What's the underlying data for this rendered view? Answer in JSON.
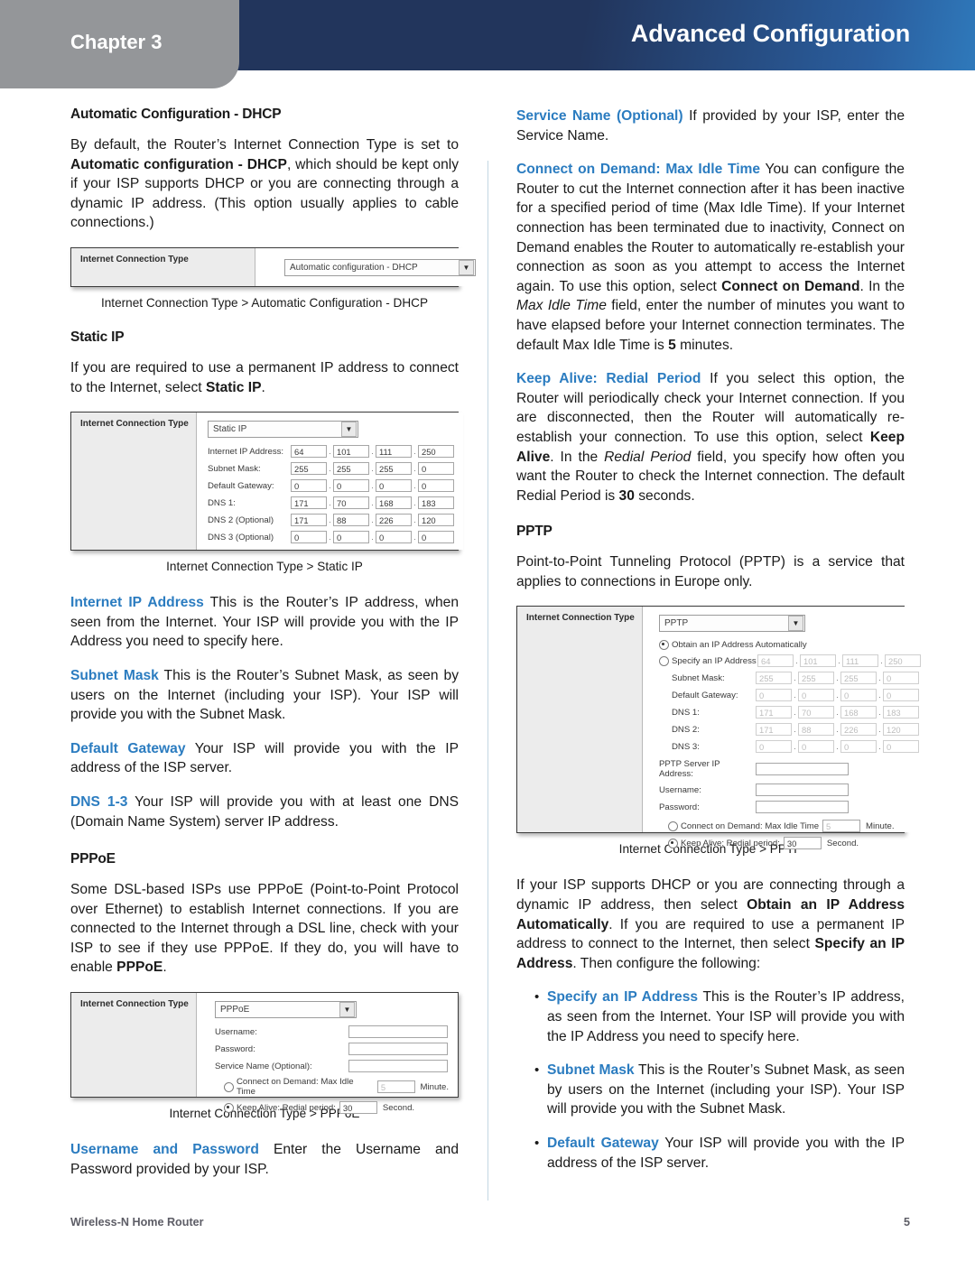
{
  "header": {
    "chapter_label": "Chapter 3",
    "title": "Advanced Configuration",
    "band_color_start": "#22355c",
    "band_color_end": "#2f79bb",
    "tab_color": "#949699"
  },
  "footer": {
    "document_name": "Wireless-N Home Router",
    "page_number": "5"
  },
  "accent_color": "#2b7cc0",
  "left_column": {
    "heading_dhcp": "Automatic Configuration - DHCP",
    "para_dhcp_1": "By default, the Router’s Internet Connection Type is set to ",
    "para_dhcp_1_bold": "Automatic configuration - DHCP",
    "para_dhcp_1_tail": ", which should be kept only if your ISP supports DHCP or you are connecting through a dynamic IP address. (This option usually applies to cable connections.)",
    "caption_dhcp": "Internet Connection Type > Automatic Configuration - DHCP",
    "heading_static": "Static IP",
    "para_static_1": "If you are required to use a permanent IP address to connect to the Internet, select ",
    "para_static_1_bold": "Static IP",
    "para_static_1_tail": ".",
    "caption_static": "Internet Connection Type > Static IP",
    "term_internet_ip": "Internet IP Address",
    "para_internet_ip": "  This is the Router’s IP address, when seen from the Internet. Your ISP will provide you with the IP Address you need to specify here.",
    "term_subnet_mask": "Subnet Mask",
    "para_subnet_mask": "  This is the Router’s Subnet Mask, as seen by users on the Internet (including your ISP). Your ISP will provide you with the Subnet Mask.",
    "term_default_gateway": "Default Gateway",
    "para_default_gateway": "  Your ISP will provide you with the IP address of the ISP server.",
    "term_dns": "DNS 1-3",
    "para_dns": "  Your ISP will provide you with at least one DNS (Domain Name System) server IP address.",
    "heading_pppoe": "PPPoE",
    "para_pppoe_1": "Some DSL-based ISPs use PPPoE (Point-to-Point Protocol over Ethernet) to establish Internet connections. If you are connected to the Internet through a DSL line, check with your ISP to see if they use PPPoE. If they do, you will have to enable ",
    "para_pppoe_1_bold": "PPPoE",
    "para_pppoe_1_tail": ".",
    "caption_pppoe": "Internet Connection Type > PPPoE",
    "term_username_password": "Username and Password",
    "para_username_password": "  Enter the Username and Password provided by your ISP."
  },
  "right_column": {
    "term_service_name": "Service Name (Optional)",
    "para_service_name": "  If provided by your ISP, enter the Service Name.",
    "term_connect_on_demand": "Connect on Demand: Max Idle Time",
    "para_cod_a": "  You can configure the Router to cut the Internet connection after it has been inactive for a specified period of time (Max Idle Time). If your Internet connection has been terminated due to inactivity, Connect on Demand enables the Router to automatically re-establish your connection as soon as you attempt to access the Internet again. To use this option, select ",
    "para_cod_bold1": "Connect on Demand",
    "para_cod_b": ". In the ",
    "para_cod_italic": "Max Idle Time",
    "para_cod_c": " field, enter the number of minutes you want to have elapsed before your Internet connection terminates. The default Max Idle Time is ",
    "para_cod_bold2": "5",
    "para_cod_d": " minutes.",
    "term_keep_alive": "Keep Alive: Redial Period",
    "para_ka_a": " If you select this option, the Router will periodically check your Internet connection. If you are disconnected, then the Router will automatically re-establish your connection. To use this option, select ",
    "para_ka_bold1": "Keep Alive",
    "para_ka_b": ". In the ",
    "para_ka_italic": "Redial Period",
    "para_ka_c": " field, you specify how often you want the Router to check the Internet connection. The default Redial Period is ",
    "para_ka_bold2": "30",
    "para_ka_d": " seconds.",
    "heading_pptp": "PPTP",
    "para_pptp_1": "Point-to-Point Tunneling Protocol (PPTP) is a service that applies to connections in Europe only.",
    "caption_pptp": "Internet Connection Type > PPTP",
    "para_dhcp_note_a": "If your ISP supports DHCP or you are connecting through a dynamic IP address, then select ",
    "para_dhcp_note_bold1": "Obtain an IP Address Automatically",
    "para_dhcp_note_b": ". If you are required to use a permanent IP address to connect to the Internet, then select ",
    "para_dhcp_note_bold2": "Specify an IP Address",
    "para_dhcp_note_c": ". Then configure the following:",
    "bullets": [
      {
        "term": "Specify an IP Address",
        "text": "  This is the Router’s IP address, as seen from the Internet. Your ISP will provide you with the IP Address you need to specify here."
      },
      {
        "term": "Subnet Mask",
        "text": " This is the Router’s Subnet Mask, as seen by users on the Internet (including your ISP). Your ISP will provide you with the Subnet Mask."
      },
      {
        "term": "Default Gateway",
        "text": "  Your ISP will provide you with the IP address of the ISP server."
      }
    ]
  },
  "figures": {
    "dhcp": {
      "panel_title": "Internet Connection Type",
      "select_value": "Automatic configuration - DHCP"
    },
    "static_ip": {
      "panel_title": "Internet Connection Type",
      "select_value": "Static IP",
      "rows": [
        {
          "label": "Internet IP Address:",
          "octets": [
            "64",
            "101",
            "111",
            "250"
          ]
        },
        {
          "label": "Subnet Mask:",
          "octets": [
            "255",
            "255",
            "255",
            "0"
          ]
        },
        {
          "label": "Default Gateway:",
          "octets": [
            "0",
            "0",
            "0",
            "0"
          ]
        },
        {
          "label": "DNS 1:",
          "octets": [
            "171",
            "70",
            "168",
            "183"
          ]
        },
        {
          "label": "DNS 2 (Optional)",
          "octets": [
            "171",
            "88",
            "226",
            "120"
          ]
        },
        {
          "label": "DNS 3 (Optional)",
          "octets": [
            "0",
            "0",
            "0",
            "0"
          ]
        }
      ]
    },
    "pppoe": {
      "panel_title": "Internet Connection Type",
      "select_value": "PPPoE",
      "field_username": "Username:",
      "field_password": "Password:",
      "field_service_name": "Service Name (Optional):",
      "radio_connect_on_demand": "Connect on Demand: Max Idle Time",
      "max_idle_value": "5",
      "unit_minute": "Minute.",
      "radio_keep_alive": "Keep Alive: Redial period:",
      "redial_value": "30",
      "unit_second": "Second."
    },
    "pptp": {
      "panel_title": "Internet Connection Type",
      "select_value": "PPTP",
      "radio_obtain_auto": "Obtain an IP Address Automatically",
      "radio_specify_ip": "Specify an IP Address",
      "specify_octets": [
        "64",
        "101",
        "111",
        "250"
      ],
      "rows": [
        {
          "label": "Subnet Mask:",
          "octets": [
            "255",
            "255",
            "255",
            "0"
          ]
        },
        {
          "label": "Default Gateway:",
          "octets": [
            "0",
            "0",
            "0",
            "0"
          ]
        },
        {
          "label": "DNS 1:",
          "octets": [
            "171",
            "70",
            "168",
            "183"
          ]
        },
        {
          "label": "DNS 2:",
          "octets": [
            "171",
            "88",
            "226",
            "120"
          ]
        },
        {
          "label": "DNS 3:",
          "octets": [
            "0",
            "0",
            "0",
            "0"
          ]
        }
      ],
      "field_server_ip": "PPTP Server IP Address:",
      "field_username": "Username:",
      "field_password": "Password:",
      "radio_connect_on_demand": "Connect on Demand: Max Idle Time",
      "max_idle_value": "5",
      "unit_minute": "Minute.",
      "radio_keep_alive": "Keep Alive: Redial period:",
      "redial_value": "30",
      "unit_second": "Second."
    }
  }
}
